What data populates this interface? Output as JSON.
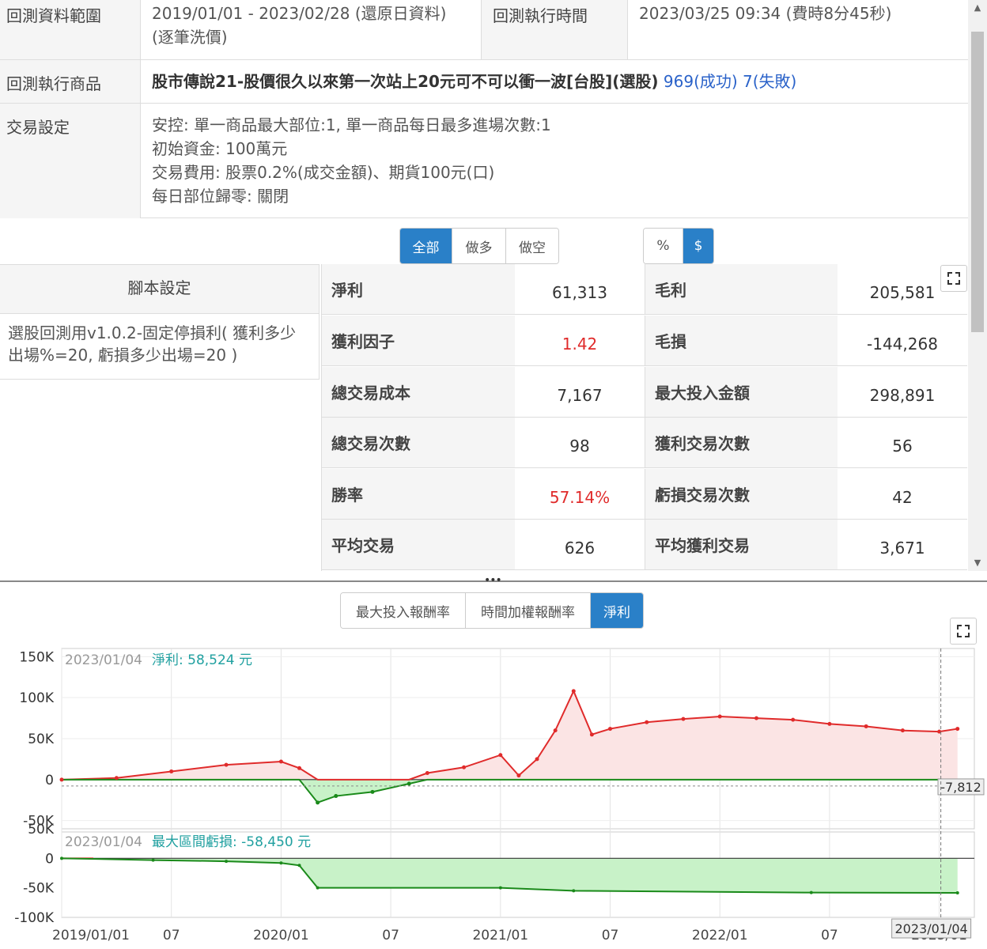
{
  "info": {
    "range_label": "回測資料範圍",
    "range_value": "2019/01/01 - 2023/02/28 (還原日資料)",
    "range_sub": "(逐筆洗價)",
    "exec_time_label": "回測執行時間",
    "exec_time_value": "2023/03/25 09:34 (費時8分45秒)",
    "product_label": "回測執行商品",
    "product_value": "股市傳說21-股價很久以來第一次站上20元可不可以衝一波[台股](選股)",
    "success": "969(成功)",
    "fail": "7(失敗)",
    "trade_label": "交易設定",
    "trade_lines": [
      "安控: 單一商品最大部位:1, 單一商品每日最多進場次數:1",
      "初始資金: 100萬元",
      "交易費用: 股票0.2%(成交金額)、期貨100元(口)",
      "每日部位歸零: 關閉"
    ]
  },
  "direction_tabs": [
    "全部",
    "做多",
    "做空"
  ],
  "unit_tabs": [
    "%",
    "$"
  ],
  "script": {
    "header": "腳本設定",
    "line1": "選股回測用v1.0.2-固定停損利( 獲利多少",
    "line2": "出場%=20, 虧損多少出場=20 )"
  },
  "stats": [
    {
      "k1": "淨利",
      "v1": "61,313",
      "k2": "毛利",
      "v2": "205,581"
    },
    {
      "k1": "獲利因子",
      "v1": "1.42",
      "k2": "毛損",
      "v2": "-144,268"
    },
    {
      "k1": "總交易成本",
      "v1": "7,167",
      "k2": "最大投入金額",
      "v2": "298,891"
    },
    {
      "k1": "總交易次數",
      "v1": "98",
      "k2": "獲利交易次數",
      "v2": "56"
    },
    {
      "k1": "勝率",
      "v1": "57.14%",
      "k2": "虧損交易次數",
      "v2": "42"
    },
    {
      "k1": "平均交易",
      "v1": "626",
      "k2": "平均獲利交易",
      "v2": "3,671"
    }
  ],
  "chart_tabs": [
    "最大投入報酬率",
    "時間加權報酬率",
    "淨利"
  ],
  "colors": {
    "accent": "#2a80c8",
    "profit": "#e02b2b",
    "loss": "#1a8a1a",
    "link": "#2a62c9",
    "teal": "#20a0a0"
  },
  "chart_data": [
    {
      "type": "area",
      "panel": "net-profit",
      "legend_date": "2023/01/04",
      "legend_label": "淨利: 58,524 元",
      "crosshair_value": "-7,812",
      "ylim": [
        -60000,
        160000
      ],
      "y_ticks": [
        "150K",
        "100K",
        "50K",
        "0",
        "-50K"
      ],
      "x_ticks": [
        "2019/01/01",
        "07",
        "2020/01",
        "07",
        "2021/01",
        "07",
        "2022/01",
        "07",
        "2023/01"
      ],
      "series": [
        {
          "x": [
            "2019/01",
            "2019/04",
            "2019/07",
            "2019/10",
            "2020/01",
            "2020/02",
            "2020/03",
            "2020/04",
            "2020/06",
            "2020/08",
            "2020/09",
            "2020/11",
            "2021/01",
            "2021/02",
            "2021/03",
            "2021/04",
            "2021/05",
            "2021/06",
            "2021/07",
            "2021/09",
            "2021/11",
            "2022/01",
            "2022/03",
            "2022/05",
            "2022/07",
            "2022/09",
            "2022/11",
            "2023/01",
            "2023/02"
          ],
          "values": [
            0,
            2000,
            10000,
            18000,
            22000,
            14000,
            -28000,
            -20000,
            -15000,
            -5000,
            8000,
            15000,
            30000,
            5000,
            25000,
            60000,
            108000,
            55000,
            62000,
            70000,
            74000,
            77000,
            75000,
            73000,
            68000,
            65000,
            60000,
            58524,
            62000
          ]
        }
      ]
    },
    {
      "type": "area",
      "panel": "drawdown",
      "legend_date": "2023/01/04",
      "legend_label": "最大區間虧損: -58,450 元",
      "crosshair_date": "2023/01/04",
      "ylim": [
        -100000,
        50000
      ],
      "y_ticks": [
        "50K",
        "0",
        "-50K",
        "-100K"
      ],
      "series": [
        {
          "x": [
            "2019/01",
            "2019/06",
            "2019/10",
            "2020/01",
            "2020/02",
            "2020/03",
            "2021/01",
            "2021/05",
            "2022/06",
            "2023/02"
          ],
          "values": [
            0,
            -3000,
            -5000,
            -8000,
            -12000,
            -50000,
            -50000,
            -55000,
            -58000,
            -58450
          ]
        }
      ]
    }
  ]
}
